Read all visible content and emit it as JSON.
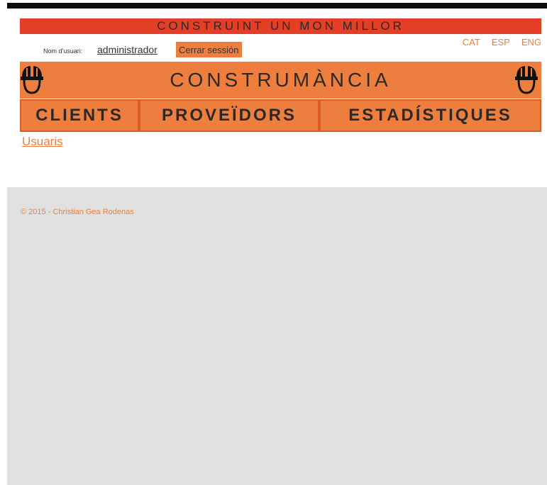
{
  "header": {
    "slogan": "CONSTRUINT UN MON MILLOR",
    "brand_title": "CONSTRUMÀNCIA"
  },
  "user": {
    "label": "Nom d'usuari:",
    "name": "administrador",
    "logout_label": "Cerrar sessión"
  },
  "languages": [
    "CAT",
    "ESP",
    "ENG"
  ],
  "nav": {
    "items": [
      {
        "label": "CLIENTS"
      },
      {
        "label": "PROVEÏDORS"
      },
      {
        "label": "ESTADÍSTIQUES"
      }
    ]
  },
  "sub_link": "Usuaris",
  "footer": {
    "text": "© 2015 - Christian Gea Rodenas"
  },
  "icons": {
    "left": "helmet-icon",
    "right": "helmet-icon"
  },
  "colors": {
    "slogan_bg": "#e43e26",
    "brand_orange": "#ee7e3e",
    "footer_bg": "#e0e0e0"
  }
}
